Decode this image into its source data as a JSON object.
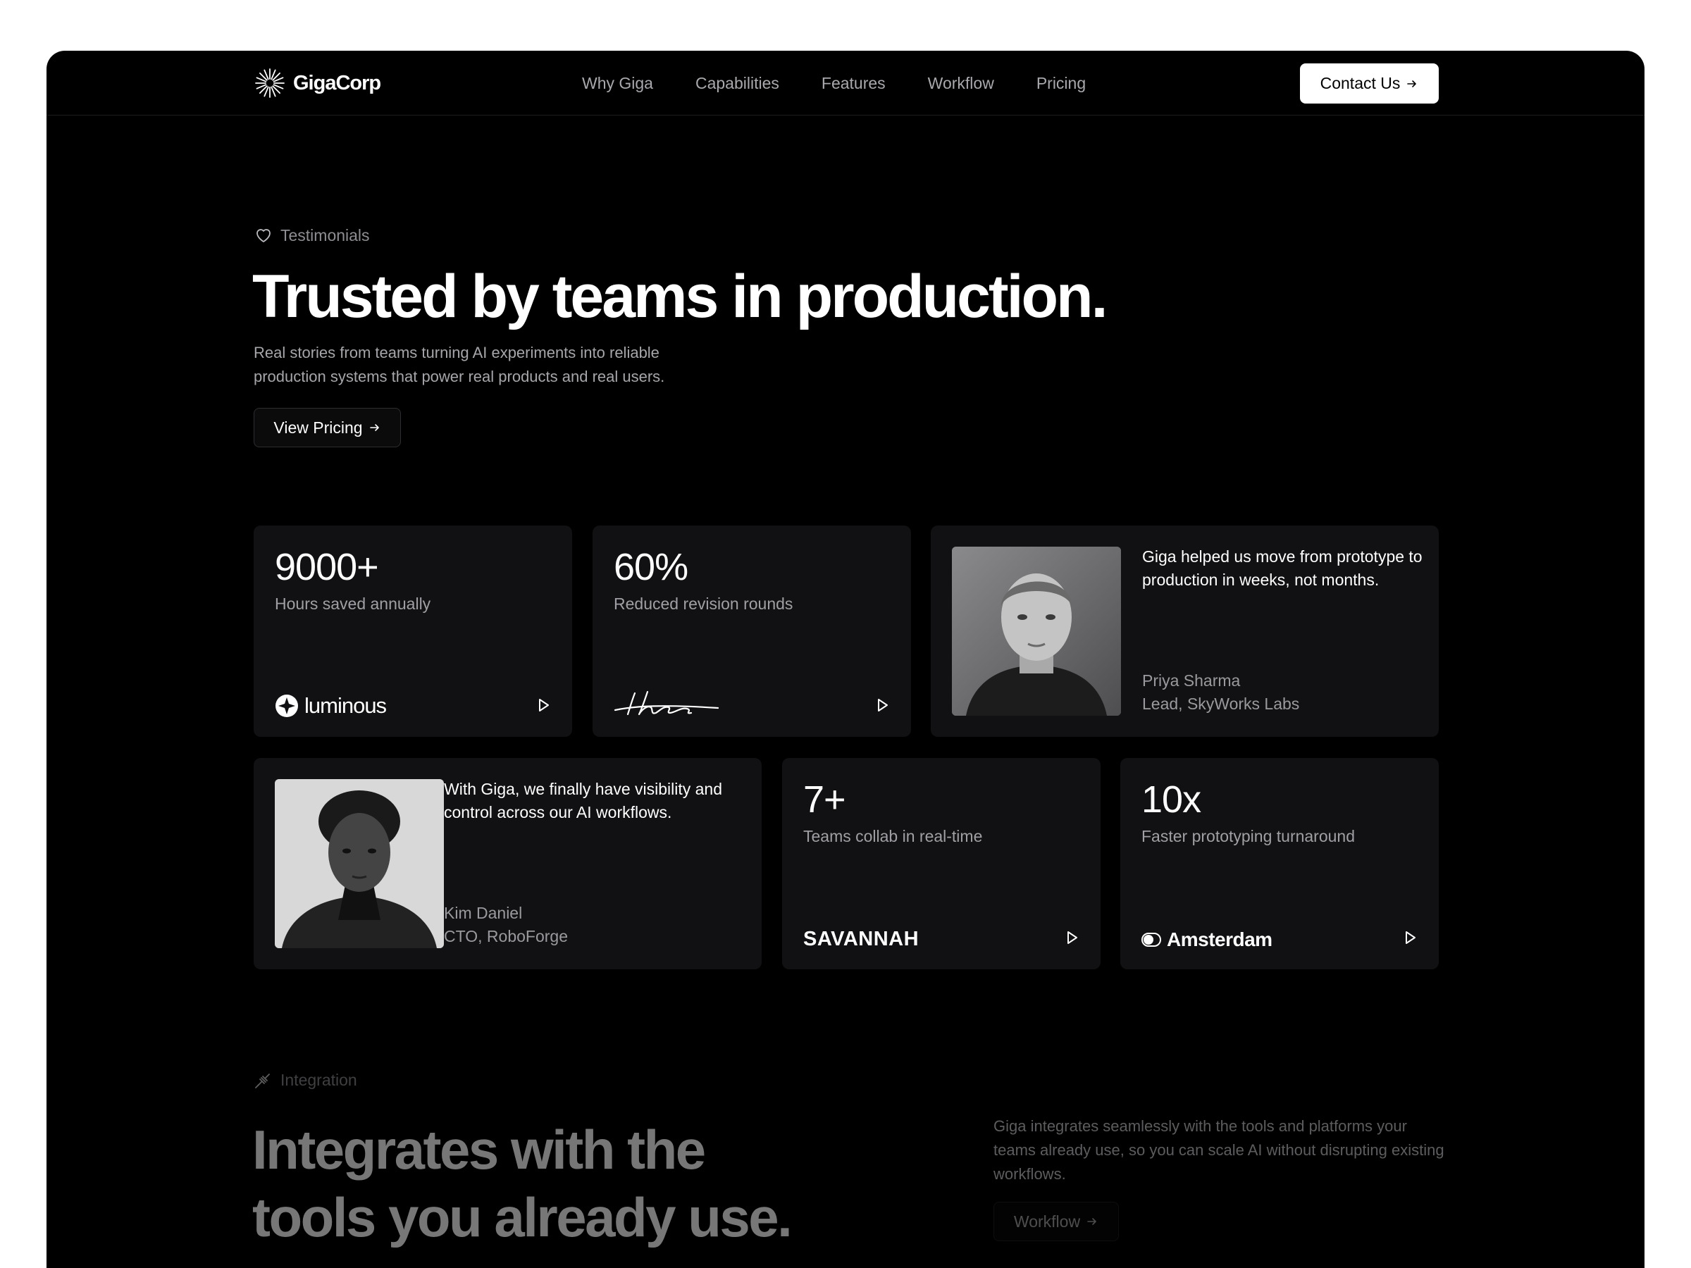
{
  "header": {
    "brand": "GigaCorp",
    "nav": [
      "Why Giga",
      "Capabilities",
      "Features",
      "Workflow",
      "Pricing"
    ],
    "cta_label": "Contact Us"
  },
  "testimonials": {
    "eyebrow": "Testimonials",
    "title": "Trusted by teams in production.",
    "subtitle": "Real stories from teams turning AI experiments into reliable production systems that power real products and real users.",
    "button_label": "View Pricing"
  },
  "stats": [
    {
      "value": "9000+",
      "label": "Hours saved annually",
      "brand": "luminous"
    },
    {
      "value": "60%",
      "label": "Reduced revision rounds",
      "brand": "theo"
    },
    {
      "value": "7+",
      "label": "Teams collab in real-time",
      "brand": "SAVANNAH"
    },
    {
      "value": "10x",
      "label": "Faster prototyping turnaround",
      "brand": "Amsterdam"
    }
  ],
  "quotes": [
    {
      "quote": "Giga helped us move from prototype to production in weeks, not months.",
      "name": "Priya Sharma",
      "role": "Lead, SkyWorks Labs"
    },
    {
      "quote": "With Giga, we finally have visibility and control across our AI workflows.",
      "name": "Kim Daniel",
      "role": "CTO, RoboForge"
    }
  ],
  "integration": {
    "eyebrow": "Integration",
    "title_line1": "Integrates with the",
    "title_line2": "tools you already use.",
    "text": "Giga integrates seamlessly with the tools and platforms your teams already use, so you can scale AI without disrupting existing workflows.",
    "button_label": "Workflow"
  },
  "icons": {
    "logo": "starburst-logo-icon",
    "arrow": "arrow-right-icon",
    "heart": "heart-icon",
    "plug": "plug-icon",
    "play": "play-icon"
  },
  "colors": {
    "background": "#000000",
    "card": "#111113",
    "accent": "#ffffff"
  }
}
